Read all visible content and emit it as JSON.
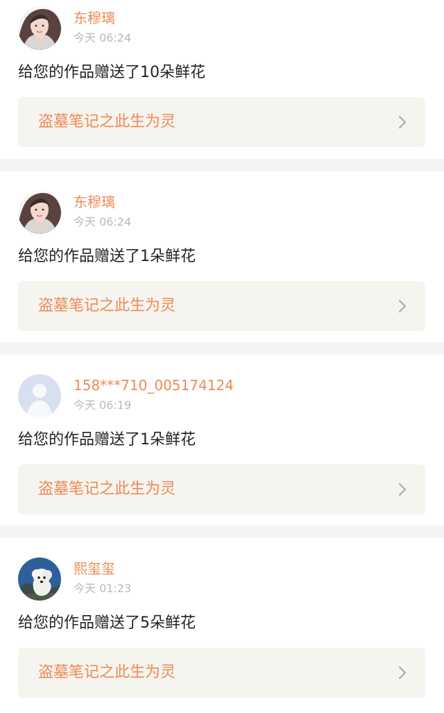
{
  "notifications": [
    {
      "avatar_icon": "portrait-avatar-icon",
      "username": "东穆璃",
      "time": "今天 06:24",
      "message": "给您的作品赠送了10朵鲜花",
      "work_title": "盗墓笔记之此生为灵",
      "action_icon": "chevron-right-icon"
    },
    {
      "avatar_icon": "portrait-avatar-icon",
      "username": "东穆璃",
      "time": "今天 06:24",
      "message": "给您的作品赠送了1朵鲜花",
      "work_title": "盗墓笔记之此生为灵",
      "action_icon": "chevron-right-icon"
    },
    {
      "avatar_icon": "default-user-avatar-icon",
      "username": "158***710_005174124",
      "time": "今天 06:19",
      "message": "给您的作品赠送了1朵鲜花",
      "work_title": "盗墓笔记之此生为灵",
      "action_icon": "chevron-right-icon"
    },
    {
      "avatar_icon": "dog-avatar-icon",
      "username": "熙玺玺",
      "time": "今天 01:23",
      "message": "给您的作品赠送了5朵鲜花",
      "work_title": "盗墓笔记之此生为灵",
      "action_icon": "chevron-right-icon"
    }
  ],
  "colors": {
    "accent": "#ec8a55",
    "page_background": "#f4f4f4",
    "card_background": "#ffffff",
    "work_link_background": "#f5f4ef",
    "message_text": "#222222",
    "time_text": "#b9b9b9"
  }
}
